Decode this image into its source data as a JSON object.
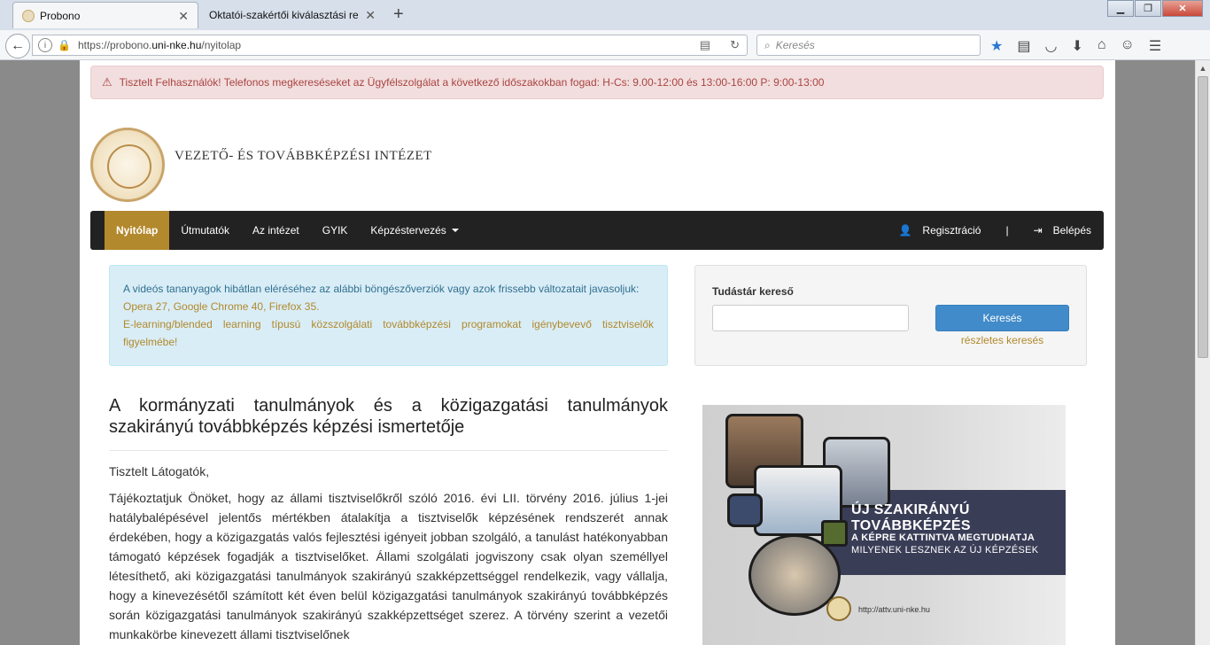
{
  "browser": {
    "tabs": [
      {
        "title": "Probono",
        "active": true
      },
      {
        "title": "Oktatói-szakértői kiválasztási re...",
        "active": false
      }
    ],
    "url_prefix": "https://probono.",
    "url_domain": "uni-nke.hu",
    "url_path": "/nyitolap",
    "search_placeholder": "Keresés"
  },
  "alert": {
    "text": "Tisztelt Felhasználók! Telefonos megkereséseket az Ügyfélszolgálat a következő időszakokban fogad: H-Cs: 9.00-12:00 és 13:00-16:00 P: 9:00-13:00"
  },
  "header": {
    "institute_name": "VEZETŐ- ÉS TOVÁBBKÉPZÉSI INTÉZET"
  },
  "nav": {
    "items": [
      {
        "label": "Nyitólap",
        "active": true
      },
      {
        "label": "Útmutatók"
      },
      {
        "label": "Az intézet"
      },
      {
        "label": "GYIK"
      },
      {
        "label": "Képzéstervezés"
      }
    ],
    "register": "Regisztráció",
    "separator": "|",
    "login": "Belépés"
  },
  "info": {
    "line1": "A videós tananyagok hibátlan eléréséhez az alábbi böngészőverziók vagy azok frissebb változatait javasoljuk:",
    "line2": "Opera 27, Google Chrome 40, Firefox 35.",
    "line3": "E-learning/blended learning típusú közszolgálati továbbképzési programokat igénybevevő tisztviselők figyelmébe!"
  },
  "search_panel": {
    "title": "Tudástár kereső",
    "input_value": "",
    "button": "Keresés",
    "link": "részletes keresés"
  },
  "article": {
    "title": "A kormányzati tanulmányok és a közigazgatási tanulmányok szakirányú továbbképzés képzési ismertetője",
    "greeting": "Tisztelt Látogatók,",
    "body": "Tájékoztatjuk Önöket, hogy az állami tisztviselőkről szóló 2016. évi LII. törvény 2016. július 1-jei hatálybalépésével jelentős mértékben átalakítja a tisztviselők képzésének rendszerét annak érdekében, hogy a közigazgatás valós fejlesztési igényeit jobban szolgáló, a tanulást hatékonyabban támogató képzések fogadják a tisztviselőket. Állami szolgálati jogviszony csak olyan személlyel létesíthető, aki közigazgatási tanulmányok szakirányú szakképzettséggel rendelkezik, vagy vállalja, hogy a kinevezésétől számított két éven belül közigazgatási tanulmányok szakirányú továbbképzés során közigazgatási tanulmányok szakirányú szakképzettséget szerez. A törvény szerint a vezetői munkakörbe kinevezett állami tisztviselőnek"
  },
  "banner": {
    "heading": "ÚJ SZAKIRÁNYÚ TOVÁBBKÉPZÉS",
    "sub1": "A KÉPRE KATTINTVA MEGTUDHATJA",
    "sub2": "MILYENEK LESZNEK AZ ÚJ KÉPZÉSEK",
    "url": "http://attv.uni-nke.hu"
  }
}
